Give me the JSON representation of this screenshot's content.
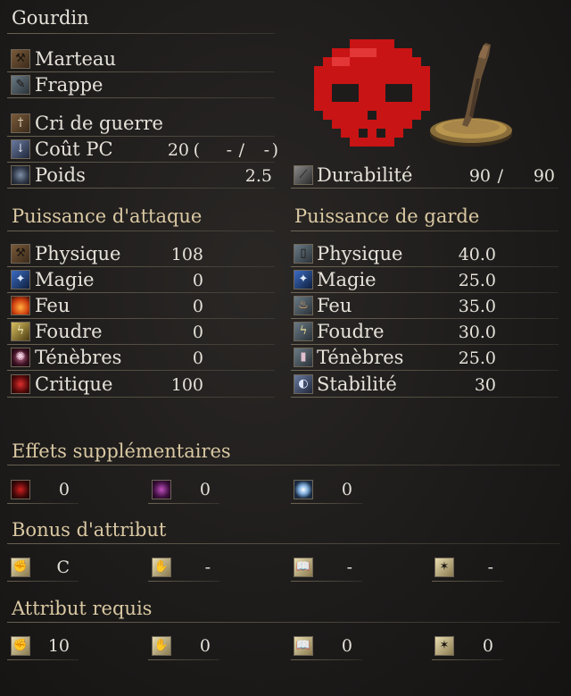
{
  "weapon_name": "Gourdin",
  "left_rows": [
    {
      "label": "Marteau",
      "icon": "hammer-icon"
    },
    {
      "label": "Frappe",
      "icon": "strike-icon"
    }
  ],
  "skill": {
    "label": "Cri de guerre",
    "icon": "dagger-icon"
  },
  "fp_cost": {
    "label": "Coût PC",
    "value": "20",
    "open": "(",
    "left": "-",
    "slash": "/",
    "right": "-",
    "close": ")"
  },
  "weight": {
    "label": "Poids",
    "value": "2.5"
  },
  "durability": {
    "label": "Durabilité",
    "current": "90",
    "slash": "/",
    "max": "90"
  },
  "attack_header": "Puissance d'attaque",
  "defense_header": "Puissance de garde",
  "attack": [
    {
      "label": "Physique",
      "value": "108",
      "icon": "physical-attack-icon"
    },
    {
      "label": "Magie",
      "value": "0",
      "icon": "magic-attack-icon"
    },
    {
      "label": "Feu",
      "value": "0",
      "icon": "fire-attack-icon"
    },
    {
      "label": "Foudre",
      "value": "0",
      "icon": "lightning-attack-icon"
    },
    {
      "label": "Ténèbres",
      "value": "0",
      "icon": "dark-attack-icon"
    },
    {
      "label": "Critique",
      "value": "100",
      "icon": "critical-icon"
    }
  ],
  "defense": [
    {
      "label": "Physique",
      "value": "40.0",
      "icon": "physical-guard-icon"
    },
    {
      "label": "Magie",
      "value": "25.0",
      "icon": "magic-guard-icon"
    },
    {
      "label": "Feu",
      "value": "35.0",
      "icon": "fire-guard-icon"
    },
    {
      "label": "Foudre",
      "value": "30.0",
      "icon": "lightning-guard-icon"
    },
    {
      "label": "Ténèbres",
      "value": "25.0",
      "icon": "dark-guard-icon"
    },
    {
      "label": "Stabilité",
      "value": "30",
      "icon": "stability-icon"
    }
  ],
  "effects_header": "Effets supplémentaires",
  "effects": [
    {
      "value": "0",
      "icon": "bleed-icon"
    },
    {
      "value": "0",
      "icon": "poison-icon"
    },
    {
      "value": "0",
      "icon": "frost-icon"
    }
  ],
  "bonus_header": "Bonus d'attribut",
  "bonus": [
    {
      "value": "C",
      "icon": "strength-icon"
    },
    {
      "value": "-",
      "icon": "dexterity-icon"
    },
    {
      "value": "-",
      "icon": "intelligence-icon"
    },
    {
      "value": "-",
      "icon": "faith-icon"
    }
  ],
  "req_header": "Attribut requis",
  "requirements": [
    {
      "value": "10",
      "icon": "strength-icon"
    },
    {
      "value": "0",
      "icon": "dexterity-icon"
    },
    {
      "value": "0",
      "icon": "intelligence-icon"
    },
    {
      "value": "0",
      "icon": "faith-icon"
    }
  ],
  "colors": {
    "header": "#d9c8a2",
    "text": "#e6e2da",
    "skull": "#d01818",
    "background": "#1e1c1b"
  }
}
